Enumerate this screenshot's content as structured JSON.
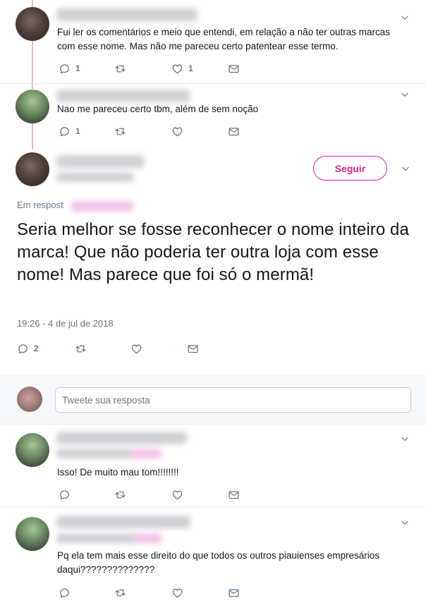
{
  "tweets": [
    {
      "text": "Fui ler os comentários e meio que entendi, em relação a não ter outras marcas com esse nome. Mas não me pareceu certo patentear esse termo.",
      "reply_count": "1",
      "like_count": "1"
    },
    {
      "text": "Nao me pareceu certo tbm, além de sem noção",
      "reply_count": "1",
      "like_count": ""
    }
  ],
  "main_tweet": {
    "follow_label": "Seguir",
    "reply_to_label": "Em respost",
    "text": "Seria melhor se fosse reconhecer o nome inteiro da marca! Que não poderia ter outra loja com esse nome! Mas parece que foi só o mermã!",
    "timestamp": "19:26 - 4 de jul de 2018",
    "reply_count": "2"
  },
  "reply_box": {
    "placeholder": "Tweete sua resposta"
  },
  "replies": [
    {
      "text": "Isso! De muito mau tom!!!!!!!!"
    },
    {
      "text": "Pq ela tem mais esse direito do que todos os outros piauienses empresários daqui??????????????"
    }
  ],
  "colors": {
    "accent": "#e0248f",
    "thread_line": "#f2b3de",
    "icon_gray": "#657786"
  },
  "icons": [
    "reply-icon",
    "retweet-icon",
    "like-icon",
    "message-icon",
    "chevron-down-icon"
  ]
}
